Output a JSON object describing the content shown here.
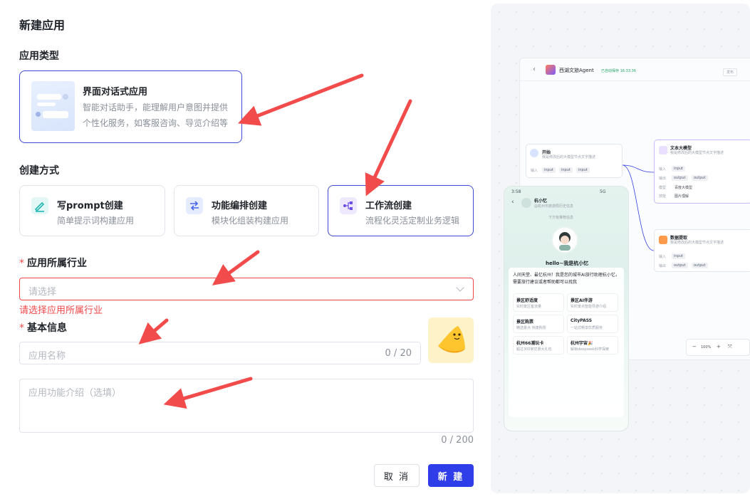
{
  "form": {
    "title": "新建应用",
    "type_label": "应用类型",
    "type_card": {
      "title": "界面对话式应用",
      "desc": "智能对话助手，能理解用户意图并提供个性化服务，如客服咨询、导览介绍等"
    },
    "method_label": "创建方式",
    "methods": [
      {
        "title": "写prompt创建",
        "desc": "简单提示词构建应用",
        "icon": "pen-icon"
      },
      {
        "title": "功能编排创建",
        "desc": "模块化组装构建应用",
        "icon": "arrange-icon"
      },
      {
        "title": "工作流创建",
        "desc": "流程化灵活定制业务逻辑",
        "icon": "workflow-icon"
      }
    ],
    "industry_label": "应用所属行业",
    "industry_placeholder": "请选择",
    "industry_error": "请选择应用所属行业",
    "basic_label": "基本信息",
    "name_placeholder": "应用名称",
    "name_count": "0 / 20",
    "intro_placeholder": "应用功能介绍（选填）",
    "intro_count": "0 / 200",
    "cancel_label": "取 消",
    "create_label": "新 建",
    "required_mark": "*"
  },
  "preview": {
    "app_name": "西湖文旅Agent",
    "saved_status": "已自动保存 16:33:36",
    "publish_label": "发布",
    "nodes": {
      "start": {
        "title": "开始",
        "desc": "我是修改后的大模型节点文字描述",
        "input_label": "输入",
        "inputs": [
          "input",
          "input",
          "input"
        ]
      },
      "llm": {
        "title": "文本大模型",
        "desc": "我是修改后的大模型节点文字描述",
        "input_label": "输入",
        "input": "input",
        "output_label": "输出",
        "outputs": [
          "output",
          "output"
        ],
        "model_label": "模型",
        "model": "百度大模型",
        "skill_label": "技能",
        "skill": "图片理解"
      },
      "extract": {
        "title": "数据提取",
        "desc": "我是修改后的大模型节点文字描述",
        "input_label": "输入",
        "input": "input",
        "output_label": "输出",
        "outputs": [
          "output",
          "output"
        ]
      }
    },
    "zoom": "100%",
    "phone": {
      "time": "3:58",
      "signal": "5G",
      "name": "杭小忆",
      "sub": "@杭州市旅游局历史信息",
      "notice": "下方有推荐信息",
      "greeting": "hello~我是杭小忆",
      "intro": "人间天堂、最忆杭州！我是您的城市AI旅行助理杭小忆，需要旅行建议或者帮助都可以找我",
      "cards": [
        {
          "title": "景区舒适度",
          "sub": "实时景区客流量"
        },
        {
          "title": "景区AI伴游",
          "sub": "实时景点智能导游介绍"
        },
        {
          "title": "景区购票",
          "sub": "精选景点 快捷购票"
        },
        {
          "title": "CityPASS",
          "sub": "一站式畅享优质服务"
        },
        {
          "title": "杭州66潮玩卡",
          "sub": "超过300家优惠大礼包"
        },
        {
          "title": "杭州宇宙🎉",
          "sub": "解锁deepseek科学探索"
        }
      ]
    }
  },
  "colors": {
    "primary": "#2f3ee8",
    "error": "#f04949",
    "arrow": "#f24b4b"
  }
}
